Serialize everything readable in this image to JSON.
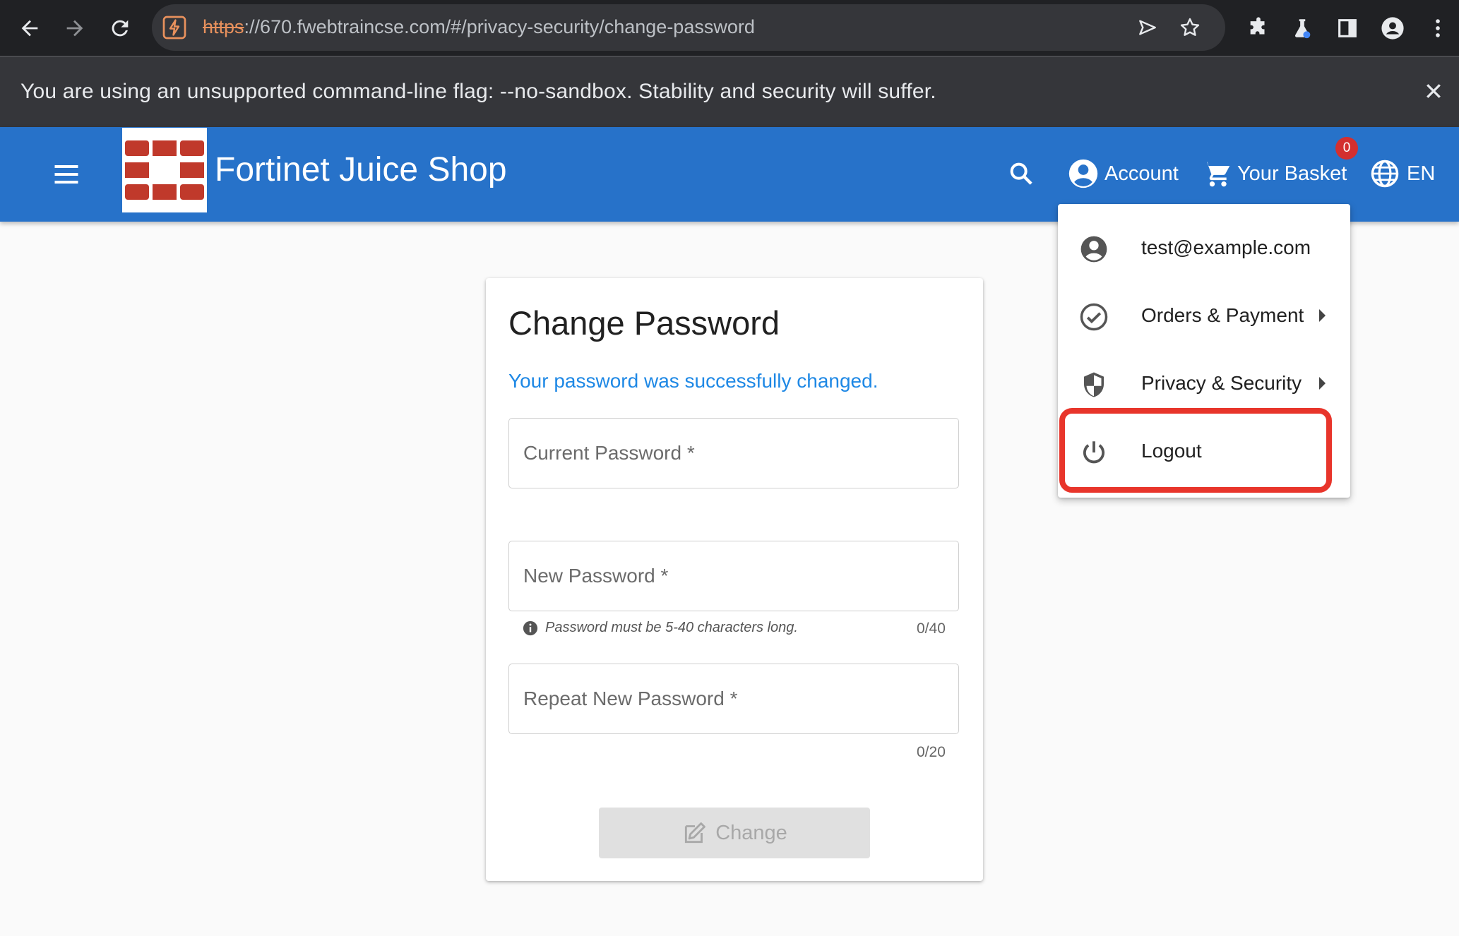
{
  "browser": {
    "url_scheme": "https",
    "url_rest": "://670.fwebtraincse.com/#/privacy-security/change-password"
  },
  "infobar": {
    "message": "You are using an unsupported command-line flag: --no-sandbox. Stability and security will suffer."
  },
  "toolbar": {
    "app_title": "Fortinet Juice Shop",
    "account_label": "Account",
    "basket_label": "Your Basket",
    "basket_count": "0",
    "language": "EN",
    "brand_color": "#2772c9"
  },
  "card": {
    "title": "Change Password",
    "success_message": "Your password was successfully changed.",
    "current_password_placeholder": "Current Password *",
    "new_password_placeholder": "New Password *",
    "new_password_hint": "Password must be 5-40 characters long.",
    "new_password_counter": "0/40",
    "repeat_password_placeholder": "Repeat New Password *",
    "repeat_password_counter": "0/20",
    "change_button": "Change"
  },
  "account_menu": {
    "items": [
      {
        "label": "test@example.com",
        "icon": "account-circle-icon"
      },
      {
        "label": "Orders & Payment",
        "icon": "check-circle-icon"
      },
      {
        "label": "Privacy & Security",
        "icon": "shield-icon"
      },
      {
        "label": "Logout",
        "icon": "power-icon"
      }
    ],
    "highlight_color": "#e8352b"
  }
}
